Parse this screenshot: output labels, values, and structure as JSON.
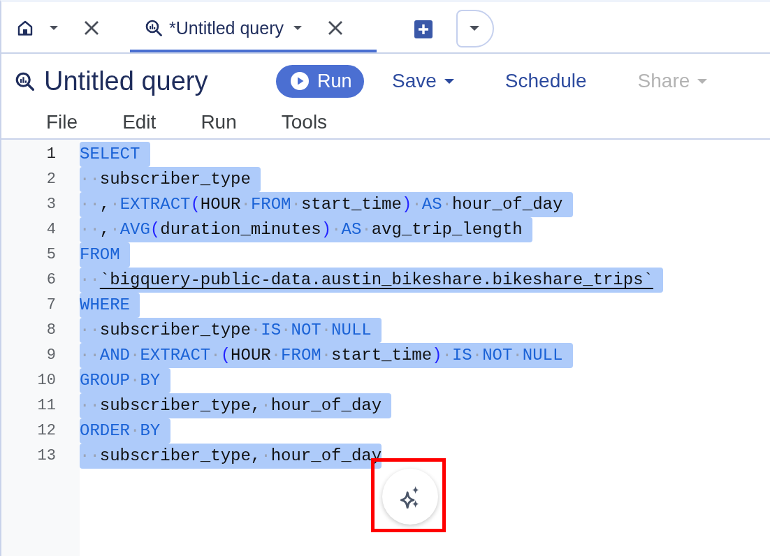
{
  "tabs": [
    {
      "kind": "home",
      "selected": false
    },
    {
      "kind": "query",
      "label": "*Untitled query",
      "selected": true
    }
  ],
  "toolbar": {
    "title": "Untitled query",
    "buttons": [
      {
        "kind": "primary",
        "label": "Run",
        "disabled": false
      },
      {
        "kind": "menu",
        "label": "Save",
        "disabled": false
      },
      {
        "kind": "link",
        "label": "Schedule",
        "disabled": false
      },
      {
        "kind": "menu",
        "label": "Share",
        "disabled": true
      }
    ]
  },
  "menu": [
    "File",
    "Edit",
    "Run",
    "Tools"
  ],
  "editor": {
    "lines": [
      {
        "number": "1",
        "current": true,
        "selected": true,
        "tokens": [
          {
            "kind": "keyword",
            "text": "SELECT"
          }
        ]
      },
      {
        "number": "2",
        "current": false,
        "selected": true,
        "tokens": [
          {
            "kind": "space",
            "text": "··"
          },
          {
            "kind": "ident",
            "text": "subscriber_type"
          }
        ]
      },
      {
        "number": "3",
        "current": false,
        "selected": true,
        "tokens": [
          {
            "kind": "space",
            "text": "··"
          },
          {
            "kind": "punct",
            "text": ","
          },
          {
            "kind": "space",
            "text": "·"
          },
          {
            "kind": "keyword",
            "text": "EXTRACT"
          },
          {
            "kind": "paren",
            "text": "("
          },
          {
            "kind": "ident",
            "text": "HOUR"
          },
          {
            "kind": "space",
            "text": "·"
          },
          {
            "kind": "keyword",
            "text": "FROM"
          },
          {
            "kind": "space",
            "text": "·"
          },
          {
            "kind": "ident",
            "text": "start_time"
          },
          {
            "kind": "paren",
            "text": ")"
          },
          {
            "kind": "space",
            "text": "·"
          },
          {
            "kind": "keyword",
            "text": "AS"
          },
          {
            "kind": "space",
            "text": "·"
          },
          {
            "kind": "ident",
            "text": "hour_of_day"
          }
        ]
      },
      {
        "number": "4",
        "current": false,
        "selected": true,
        "tokens": [
          {
            "kind": "space",
            "text": "··"
          },
          {
            "kind": "punct",
            "text": ","
          },
          {
            "kind": "space",
            "text": "·"
          },
          {
            "kind": "keyword",
            "text": "AVG"
          },
          {
            "kind": "paren",
            "text": "("
          },
          {
            "kind": "ident",
            "text": "duration_minutes"
          },
          {
            "kind": "paren",
            "text": ")"
          },
          {
            "kind": "space",
            "text": "·"
          },
          {
            "kind": "keyword",
            "text": "AS"
          },
          {
            "kind": "space",
            "text": "·"
          },
          {
            "kind": "ident",
            "text": "avg_trip_length"
          }
        ]
      },
      {
        "number": "5",
        "current": false,
        "selected": true,
        "tokens": [
          {
            "kind": "keyword",
            "text": "FROM"
          }
        ]
      },
      {
        "number": "6",
        "current": false,
        "selected": true,
        "tokens": [
          {
            "kind": "space",
            "text": "··"
          },
          {
            "kind": "table",
            "text": "`bigquery-public-data.austin_bikeshare.bikeshare_trips`"
          }
        ]
      },
      {
        "number": "7",
        "current": false,
        "selected": true,
        "tokens": [
          {
            "kind": "keyword",
            "text": "WHERE"
          }
        ]
      },
      {
        "number": "8",
        "current": false,
        "selected": true,
        "tokens": [
          {
            "kind": "space",
            "text": "··"
          },
          {
            "kind": "ident",
            "text": "subscriber_type"
          },
          {
            "kind": "space",
            "text": "·"
          },
          {
            "kind": "keyword",
            "text": "IS"
          },
          {
            "kind": "space",
            "text": "·"
          },
          {
            "kind": "keyword",
            "text": "NOT"
          },
          {
            "kind": "space",
            "text": "·"
          },
          {
            "kind": "keyword",
            "text": "NULL"
          }
        ]
      },
      {
        "number": "9",
        "current": false,
        "selected": true,
        "tokens": [
          {
            "kind": "space",
            "text": "··"
          },
          {
            "kind": "keyword",
            "text": "AND"
          },
          {
            "kind": "space",
            "text": "·"
          },
          {
            "kind": "keyword",
            "text": "EXTRACT"
          },
          {
            "kind": "space",
            "text": "·"
          },
          {
            "kind": "paren",
            "text": "("
          },
          {
            "kind": "ident",
            "text": "HOUR"
          },
          {
            "kind": "space",
            "text": "·"
          },
          {
            "kind": "keyword",
            "text": "FROM"
          },
          {
            "kind": "space",
            "text": "·"
          },
          {
            "kind": "ident",
            "text": "start_time"
          },
          {
            "kind": "paren",
            "text": ")"
          },
          {
            "kind": "space",
            "text": "·"
          },
          {
            "kind": "keyword",
            "text": "IS"
          },
          {
            "kind": "space",
            "text": "·"
          },
          {
            "kind": "keyword",
            "text": "NOT"
          },
          {
            "kind": "space",
            "text": "·"
          },
          {
            "kind": "keyword",
            "text": "NULL"
          }
        ]
      },
      {
        "number": "10",
        "current": false,
        "selected": true,
        "tokens": [
          {
            "kind": "keyword",
            "text": "GROUP"
          },
          {
            "kind": "space",
            "text": "·"
          },
          {
            "kind": "keyword",
            "text": "BY"
          }
        ]
      },
      {
        "number": "11",
        "current": false,
        "selected": true,
        "tokens": [
          {
            "kind": "space",
            "text": "··"
          },
          {
            "kind": "ident",
            "text": "subscriber_type,"
          },
          {
            "kind": "space",
            "text": "·"
          },
          {
            "kind": "ident",
            "text": "hour_of_day"
          }
        ]
      },
      {
        "number": "12",
        "current": false,
        "selected": true,
        "tokens": [
          {
            "kind": "keyword",
            "text": "ORDER"
          },
          {
            "kind": "space",
            "text": "·"
          },
          {
            "kind": "keyword",
            "text": "BY"
          }
        ]
      },
      {
        "number": "13",
        "current": false,
        "selected": true,
        "tokens": [
          {
            "kind": "space",
            "text": "··"
          },
          {
            "kind": "ident",
            "text": "subscriber_type,"
          },
          {
            "kind": "space",
            "text": "·"
          },
          {
            "kind": "ident",
            "text": "hour_of_day"
          }
        ]
      }
    ]
  },
  "assist_button": {
    "highlighted": true
  }
}
